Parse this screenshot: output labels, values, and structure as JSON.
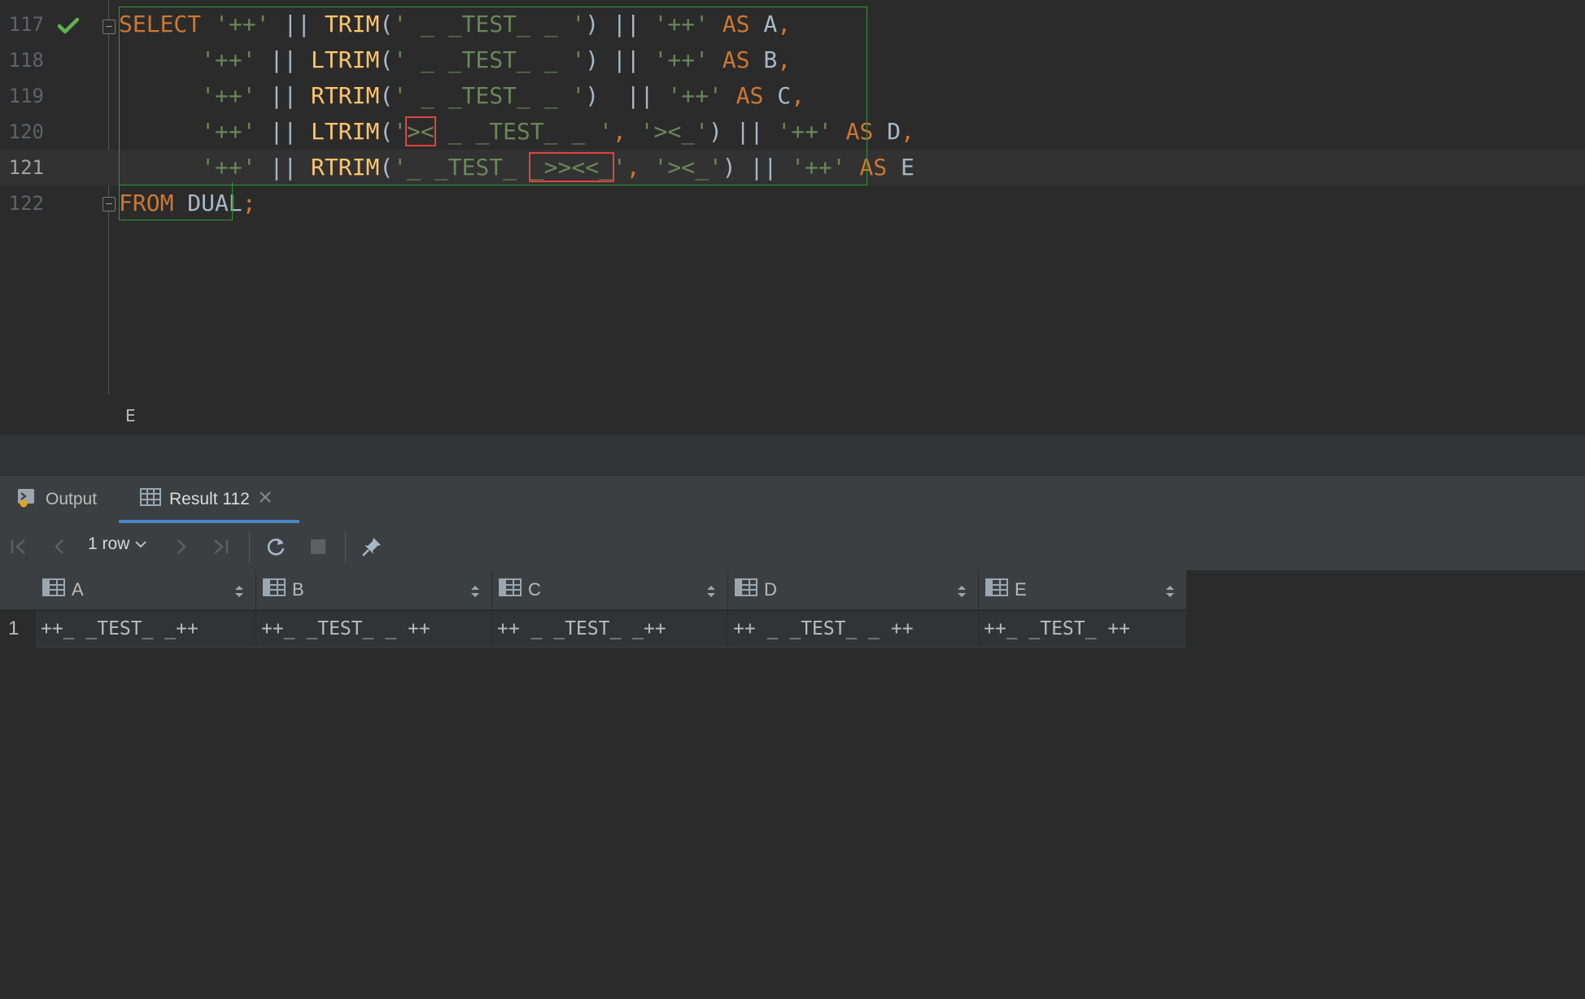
{
  "editor": {
    "lines": [
      {
        "num": "117"
      },
      {
        "num": "118"
      },
      {
        "num": "119"
      },
      {
        "num": "120"
      },
      {
        "num": "121"
      },
      {
        "num": "122"
      }
    ],
    "current_line": "121"
  },
  "breadcrumb": {
    "text": "E"
  },
  "tabs": {
    "output_label": "Output",
    "result_label": "Result 112"
  },
  "toolbar": {
    "rows_label": "1 row"
  },
  "grid": {
    "columns": [
      "A",
      "B",
      "C",
      "D",
      "E"
    ],
    "rows": [
      {
        "num": "1",
        "cells": [
          "++_ _TEST_ _++",
          "++_ _TEST_ _ ++",
          "++ _ _TEST_ _++",
          "++ _ _TEST_ _ ++",
          "++_ _TEST_ ++"
        ]
      }
    ]
  },
  "colors": {
    "keyword": "#cc7832",
    "string": "#6a8759",
    "function": "#ffc66d",
    "text": "#a9b7c6",
    "match_outline": "#2f9a2f",
    "highlight_box": "#e0443e",
    "tab_accent": "#4a88c7"
  },
  "icons": {
    "check": "check-icon",
    "output": "output-icon",
    "result": "table-icon",
    "close": "close-icon"
  }
}
